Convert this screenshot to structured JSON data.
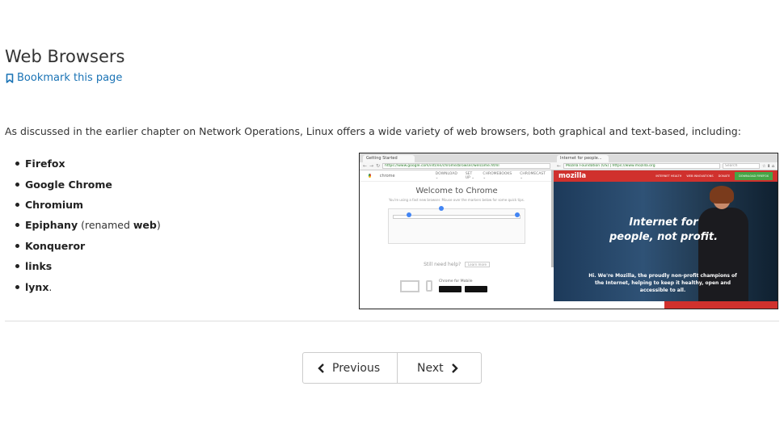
{
  "page": {
    "title": "Web Browsers",
    "bookmark_label": "Bookmark this page",
    "intro_text": "As discussed in the earlier chapter on Network Operations, Linux offers a wide variety of web browsers, both graphical and text-based, including:"
  },
  "browsers": [
    {
      "name": "Firefox",
      "note": ""
    },
    {
      "name": "Google Chrome",
      "note": ""
    },
    {
      "name": "Chromium",
      "note": ""
    },
    {
      "name": "Epiphany",
      "note": " (renamed ",
      "note_bold": "web",
      "note_end": ")"
    },
    {
      "name": "Konqueror",
      "note": ""
    },
    {
      "name": "links",
      "note": ""
    },
    {
      "name": "lynx",
      "note": "."
    }
  ],
  "figure": {
    "chrome_tab": "Getting Started",
    "chrome_url": "https://www.google.com/intl/en/chrome/browser/welcome.html",
    "chrome_brand": "chrome",
    "chrome_nav": [
      "DOWNLOAD ⌄",
      "SET UP ⌄",
      "CHROMEBOOKS ⌄",
      "CHROMECAST ⌄"
    ],
    "chrome_heading": "Welcome to Chrome",
    "chrome_sub": "You're using a fast new browser. Mouse over the markers below for some quick tips.",
    "chrome_help": "Still need help?",
    "chrome_help_btn": "Learn more",
    "chrome_mobile": "Chrome for Mobile",
    "firefox_tab": "Internet for people...",
    "firefox_url": "Mozilla Foundation (US) | https://www.mozilla.org",
    "firefox_search": "Search",
    "moz_logo": "mozilla",
    "moz_menu": [
      "INTERNET HEALTH",
      "WEB INNOVATIONS",
      "DONATE"
    ],
    "moz_download": "DOWNLOAD FIREFOX",
    "hero_title": "Internet for people, not profit.",
    "hero_sub": "Hi. We're Mozilla, the proudly non-profit champions of the Internet, helping to keep it healthy, open and accessible to all."
  },
  "pager": {
    "previous_label": "Previous",
    "next_label": "Next"
  },
  "colors": {
    "link": "#1a73b5",
    "mozilla_red": "#d0312d"
  }
}
